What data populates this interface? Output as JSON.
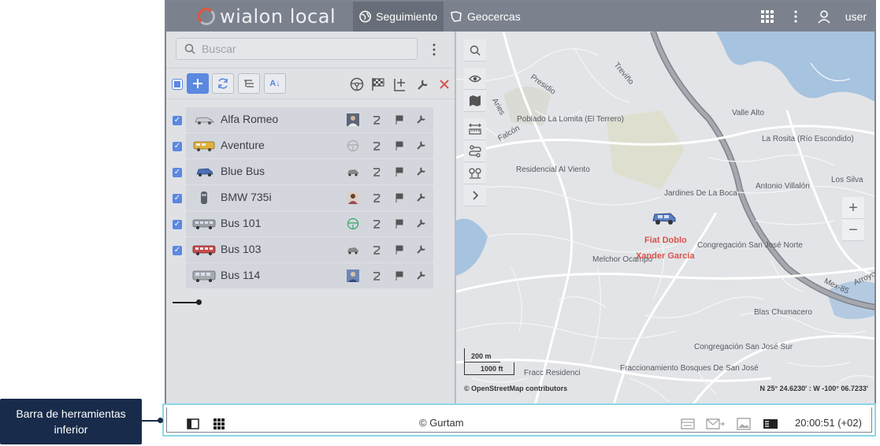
{
  "topbar": {
    "logo_text": "wialon local",
    "tabs": [
      {
        "label": "Seguimiento",
        "icon": "globe-icon",
        "active": true
      },
      {
        "label": "Geocercas",
        "icon": "geofence-icon",
        "active": false
      }
    ],
    "user": "user"
  },
  "panel": {
    "search_placeholder": "Buscar",
    "sort_label": "A↓",
    "units": [
      {
        "name": "Alfa Romeo",
        "checked": true,
        "driver": "driver-photo"
      },
      {
        "name": "Aventure",
        "checked": true,
        "driver": "steering-wheel-icon"
      },
      {
        "name": "Blue Bus",
        "checked": true,
        "driver": "car-small-icon"
      },
      {
        "name": "BMW 735i",
        "checked": true,
        "driver": "driver-photo"
      },
      {
        "name": "Bus 101",
        "checked": true,
        "driver": "steering-wheel-green-icon"
      },
      {
        "name": "Bus 103",
        "checked": true,
        "driver": "car-small-icon"
      },
      {
        "name": "Bus 114",
        "checked": false,
        "driver": "driver-photo"
      }
    ]
  },
  "map": {
    "labels": {
      "presidio": "Presidio",
      "trevino": "Treviño",
      "aries": "Aries",
      "falcon": "Falcón",
      "lomita": "Poblado La Lomita (El Terrero)",
      "valle_alto": "Valle Alto",
      "la_rosita": "La Rosita (Río Escondido)",
      "residencial": "Residencial Al Viento",
      "los_silva": "Los Silva",
      "antonio": "Antonio Villalón",
      "jardines": "Jardines De La Boca",
      "cong_norte": "Congregación San José Norte",
      "melchor": "Melchor Ocampo",
      "mex85": "Mex-85",
      "arroyo": "Arroyo",
      "chumacero": "Blas Chumacero",
      "cong_sur": "Congregación San José Sur",
      "fracc_res": "Fracc Residenci",
      "fracc_bosques": "Fraccionamiento Bosques De San José"
    },
    "unit_label": "Fiat Doblo",
    "driver_label": "Xander García",
    "scale_m": "200 m",
    "scale_ft": "1000 ft",
    "attribution": "© OpenStreetMap contributors",
    "coordinates": "N 25° 24.6230' : W -100° 06.7233'",
    "zoom_in": "+",
    "zoom_out": "−"
  },
  "bottombar": {
    "copyright": "© Gurtam",
    "time": "20:00:51 (+02)"
  },
  "callout": {
    "line1": "Barra de herramientas",
    "line2": "inferior"
  },
  "colors": {
    "accent": "#5b88e0",
    "topbar": "#7b818d",
    "callout": "#182b4a",
    "highlight": "#8ad7e6",
    "unit_label": "#d9534f"
  }
}
